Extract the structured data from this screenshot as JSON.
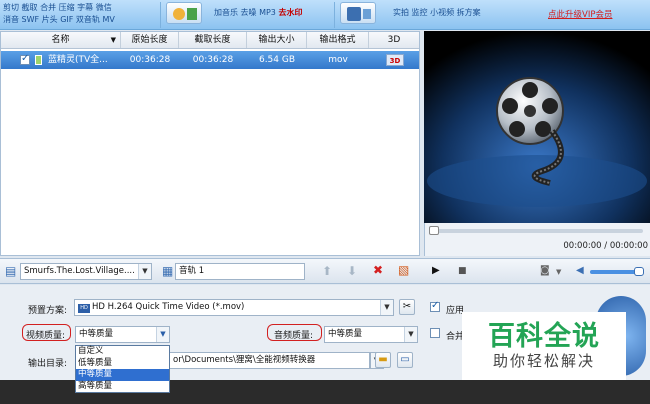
{
  "toolbar": {
    "edit_line1": "剪切 截取 合并 压缩 字幕 微信",
    "edit_line2": "消音 SWF 片头 GIF 双音轨 MV",
    "audio_tools": "加音乐 去噪 MP3",
    "watermark_tool": "去水印",
    "record_tools": "实拍 监控 小视频 拆方案",
    "vip_link": "点此升级VIP会员"
  },
  "filelist": {
    "columns": [
      "名称",
      "原始长度",
      "截取长度",
      "输出大小",
      "输出格式",
      "3D"
    ],
    "rows": [
      {
        "name": "蓝精灵(TV全...",
        "original_length": "00:36:28",
        "cut_length": "00:36:28",
        "output_size": "6.54 GB",
        "output_format": "mov",
        "three_d": "3D"
      }
    ]
  },
  "player": {
    "time": "00:00:00 / 00:00:00"
  },
  "midbar": {
    "subtitle_file": "Smurfs.The.Lost.Village....",
    "audio_track": "音轨 1"
  },
  "settings": {
    "preset_label": "预置方案:",
    "preset_value": "HD H.264 Quick Time Video (*.mov)",
    "apply_label": "应用",
    "merge_label": "合并",
    "video_quality_label": "视频质量:",
    "video_quality_value": "中等质量",
    "audio_quality_label": "音频质量:",
    "audio_quality_value": "中等质量",
    "output_dir_label": "输出目录:",
    "output_dir_value": "or\\Documents\\狸窝\\全能视频转换器",
    "quality_options": [
      "自定义",
      "低等质量",
      "中等质量",
      "高等质量"
    ],
    "selected_option_index": 2
  },
  "watermark": {
    "title": "百科全说",
    "subtitle": "助你轻松解决"
  },
  "colors": {
    "row_selected": "#3478cb",
    "highlight_red": "#d22020",
    "watermark_green": "#23a455"
  }
}
